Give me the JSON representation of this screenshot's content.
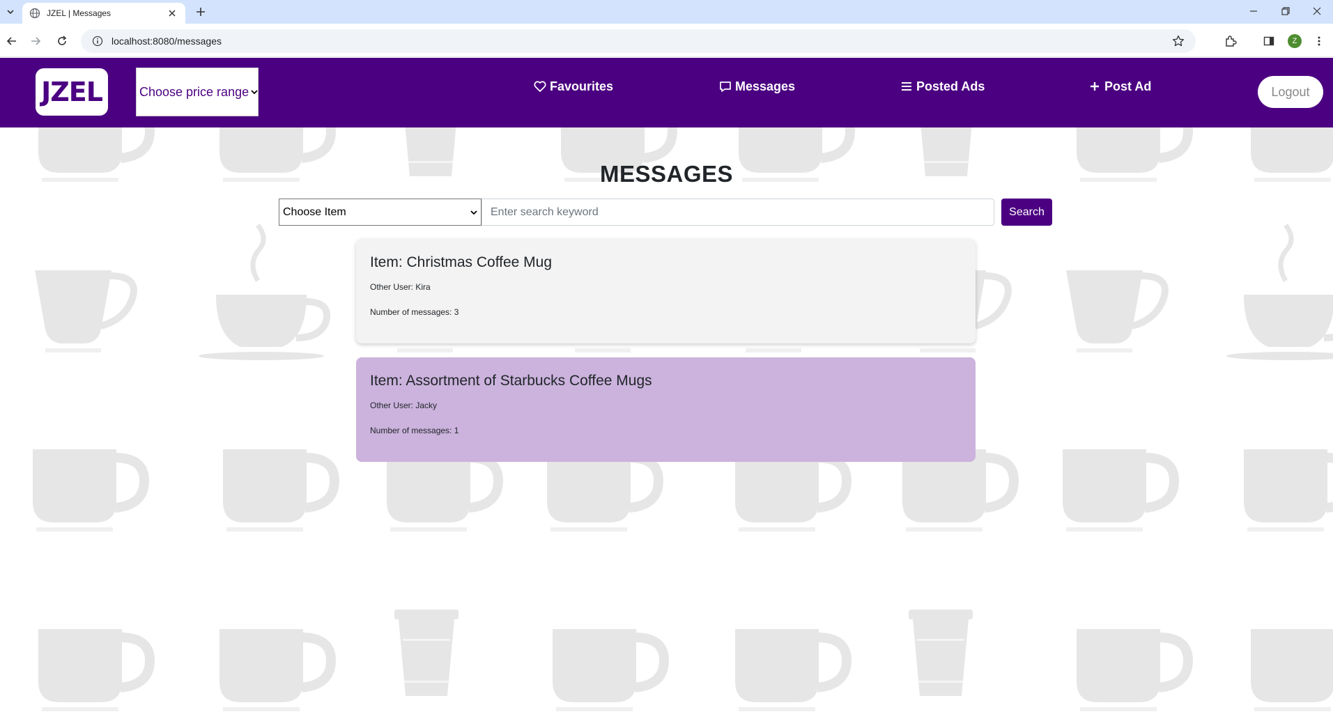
{
  "browser": {
    "tab_title": "JZEL | Messages",
    "url": "localhost:8080/messages",
    "profile_initial": "Z"
  },
  "navbar": {
    "logo": "JZEL",
    "price_select": "Choose price range",
    "links": {
      "favourites": "Favourites",
      "messages": "Messages",
      "posted_ads": "Posted Ads",
      "post_ad": "Post Ad"
    },
    "logout": "Logout",
    "background_color": "#4b0081"
  },
  "page": {
    "title": "MESSAGES",
    "item_select": "Choose Item",
    "search_placeholder": "Enter search keyword",
    "search_button": "Search"
  },
  "conversations": [
    {
      "item": "Item: Christmas Coffee Mug",
      "other_user": "Other User: Kira",
      "count": "Number of messages: 3",
      "highlight": false
    },
    {
      "item": "Item: Assortment of Starbucks Coffee Mugs",
      "other_user": "Other User: Jacky",
      "count": "Number of messages: 1",
      "highlight": true
    }
  ]
}
